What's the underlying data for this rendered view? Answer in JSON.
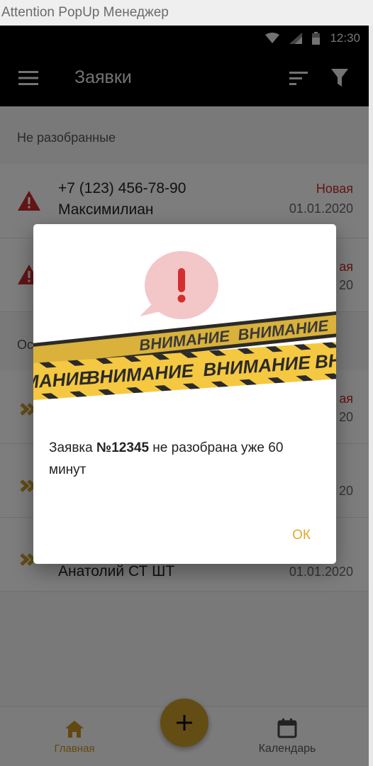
{
  "window": {
    "title": "Attention PopUp Менеджер"
  },
  "statusbar": {
    "time": "12:30"
  },
  "toolbar": {
    "title": "Заявки"
  },
  "sections": [
    {
      "header": "Не разобранные"
    },
    {
      "header": "Ос"
    }
  ],
  "rows": [
    {
      "phone": "+7 (123) 456-78-90",
      "name": "Максимилиан",
      "status": "Новая",
      "date": "01.01.2020"
    },
    {
      "status": "ая",
      "date": "20"
    },
    {
      "status": "ая",
      "date": "20"
    },
    {
      "date": "20"
    },
    {
      "name": "Анатолий СТ ШТ",
      "date": "01.01.2020"
    }
  ],
  "dialog": {
    "tape_text": "ВНИМАНИЕ",
    "message_prefix": "Заявка ",
    "message_bold": "№12345",
    "message_suffix": " не разобрана уже 60 минут",
    "ok_label": "ОК"
  },
  "bottom_nav": {
    "home_label": "Главная",
    "calendar_label": "Календарь"
  },
  "colors": {
    "accent": "#c79a2b",
    "ok": "#e0a82a",
    "alert": "#c62828",
    "tape_yellow": "#f5c842"
  }
}
